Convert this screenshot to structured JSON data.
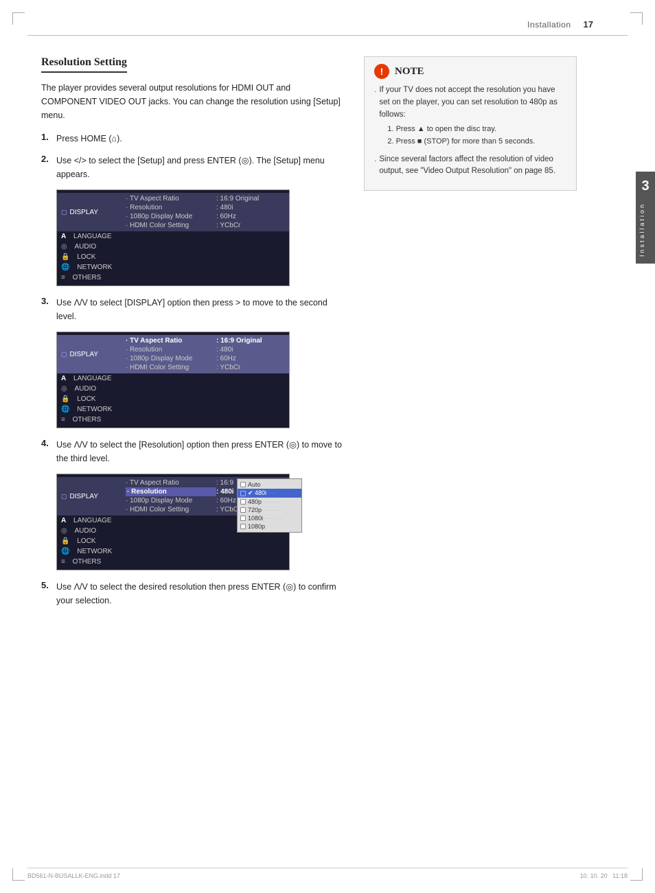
{
  "header": {
    "section": "Installation",
    "page_number": "17"
  },
  "chapter": {
    "number": "3",
    "label": "Installation"
  },
  "section_title": "Resolution Setting",
  "intro_text": "The player provides several output resolutions for HDMI OUT and COMPONENT VIDEO OUT jacks. You can change the resolution using [Setup] menu.",
  "steps": [
    {
      "number": "1.",
      "text": "Press HOME (",
      "symbol": "⌂",
      "text_after": ")."
    },
    {
      "number": "2.",
      "main": "Use </> to select the [Setup] and press ENTER (",
      "symbol": "⊙",
      "after": "). The [Setup] menu appears."
    },
    {
      "number": "3.",
      "text": "Use Λ/V to select [DISPLAY] option then press > to move to the second level."
    },
    {
      "number": "4.",
      "text": "Use Λ/V to select the [Resolution] option then press ENTER (",
      "symbol": "⊙",
      "after": ") to move to the third level."
    },
    {
      "number": "5.",
      "text": "Use Λ/V to select the desired resolution then press ENTER (",
      "symbol": "⊙",
      "after": ") to confirm your selection."
    }
  ],
  "menu1": {
    "rows": [
      {
        "icon": "display",
        "label": "DISPLAY",
        "items": [
          "· TV Aspect Ratio",
          "· Resolution",
          "· 1080p Display Mode",
          "· HDMI Color Setting"
        ],
        "values": [
          ": 16:9 Original",
          ": 480i",
          ": 60Hz",
          ": YCbCr"
        ],
        "active": true
      },
      {
        "icon": "A",
        "label": "LANGUAGE",
        "items": [],
        "values": []
      },
      {
        "icon": "◎",
        "label": "AUDIO",
        "items": [],
        "values": []
      },
      {
        "icon": "🔒",
        "label": "LOCK",
        "items": [],
        "values": []
      },
      {
        "icon": "🌐",
        "label": "NETWORK",
        "items": [],
        "values": []
      },
      {
        "icon": "≡",
        "label": "OTHERS",
        "items": [],
        "values": []
      }
    ]
  },
  "menu2": {
    "rows": [
      {
        "icon": "display",
        "label": "DISPLAY",
        "items": [
          "· TV Aspect Ratio",
          "· Resolution",
          "· 1080p Display Mode",
          "· HDMI Color Setting"
        ],
        "values": [
          ": 16:9 Original",
          ": 480i",
          ": 60Hz",
          ": YCbCr"
        ],
        "active": true,
        "highlight_row": 0
      },
      {
        "icon": "A",
        "label": "LANGUAGE"
      },
      {
        "icon": "◎",
        "label": "AUDIO"
      },
      {
        "icon": "🔒",
        "label": "LOCK"
      },
      {
        "icon": "🌐",
        "label": "NETWORK"
      },
      {
        "icon": "≡",
        "label": "OTHERS"
      }
    ]
  },
  "menu3": {
    "items": [
      "· TV Aspect Ratio",
      "· Resolution",
      "· 1080p Display Mode",
      "· HDMI Color Setting"
    ],
    "values": [
      ": 16:9",
      ": 480i",
      ": 60Hz",
      ": YCbCr"
    ],
    "resolution_options": [
      "Auto",
      "480i",
      "480p",
      "720p",
      "1080i",
      "1080p"
    ]
  },
  "note": {
    "title": "NOTE",
    "bullets": [
      {
        "text": "If your TV does not accept the resolution you have set on the player, you can set resolution to 480p as follows:",
        "sub_items": [
          "Press ▲ to open the disc tray.",
          "Press ■ (STOP) for more than 5 seconds."
        ]
      },
      {
        "text": "Since several factors affect the resolution of video output, see \"Video Output Resolution\" on page 85."
      }
    ]
  },
  "footer": {
    "filename": "BD561-N-BUSALLK-ENG.indd   17",
    "page": "",
    "date": "10. 10. 20",
    "time": "11:18"
  }
}
